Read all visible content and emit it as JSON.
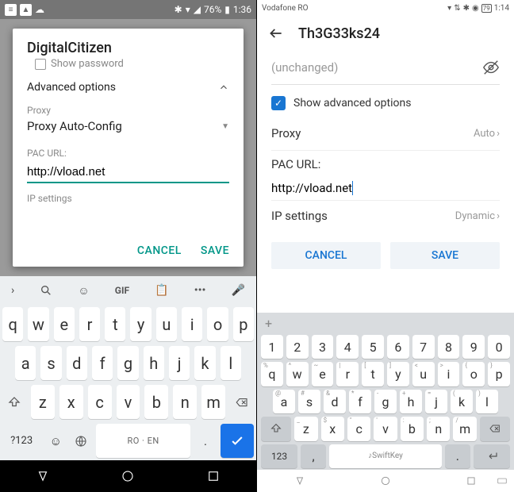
{
  "left": {
    "status": {
      "battery": "76%",
      "time": "1:36"
    },
    "dialog": {
      "title": "DigitalCitizen",
      "showPassword": "Show password",
      "advanced": "Advanced options",
      "proxyLabel": "Proxy",
      "proxyValue": "Proxy Auto-Config",
      "pacLabel": "PAC URL:",
      "pacValue": "http://vload.net",
      "ipSettings": "IP settings",
      "cancel": "CANCEL",
      "save": "SAVE"
    },
    "keyboard": {
      "gif": "GIF",
      "row1": [
        "q",
        "w",
        "e",
        "r",
        "t",
        "y",
        "u",
        "i",
        "o",
        "p"
      ],
      "row2": [
        "a",
        "s",
        "d",
        "f",
        "g",
        "h",
        "j",
        "k",
        "l"
      ],
      "row3": [
        "z",
        "x",
        "c",
        "v",
        "b",
        "n",
        "m"
      ],
      "numToggle": "?123",
      "space": "RO · EN",
      "period": "."
    }
  },
  "right": {
    "status": {
      "carrier": "Vodafone RO",
      "battery": "79",
      "time": "1:14"
    },
    "title": "Th3G33ks24",
    "unchanged": "(unchanged)",
    "showAdvanced": "Show advanced options",
    "proxy": {
      "label": "Proxy",
      "value": "Auto"
    },
    "pacLabel": "PAC URL:",
    "pacValue": "http://vload.net",
    "ipSettings": {
      "label": "IP settings",
      "value": "Dynamic"
    },
    "cancel": "CANCEL",
    "save": "SAVE",
    "keyboard": {
      "numRow": [
        "1",
        "2",
        "3",
        "4",
        "5",
        "6",
        "7",
        "8",
        "9",
        "0"
      ],
      "row1": [
        [
          "q",
          "%"
        ],
        [
          "w",
          "^"
        ],
        [
          "e",
          "~"
        ],
        [
          "r",
          "|"
        ],
        [
          "t",
          "["
        ],
        [
          "y",
          "]"
        ],
        [
          "u",
          "<"
        ],
        [
          "i",
          ">"
        ],
        [
          "o",
          "{"
        ],
        [
          "p",
          "}"
        ]
      ],
      "row2": [
        [
          "a",
          "@"
        ],
        [
          "s",
          "#"
        ],
        [
          "d",
          "&"
        ],
        [
          "f",
          "*"
        ],
        [
          "g",
          "-"
        ],
        [
          "h",
          "+"
        ],
        [
          "j",
          "="
        ],
        [
          "k",
          "("
        ],
        [
          "l",
          ")"
        ]
      ],
      "row3": [
        [
          "z",
          "_"
        ],
        [
          "x",
          "$"
        ],
        [
          "c",
          "\""
        ],
        [
          "v",
          "'"
        ],
        [
          "b",
          ":"
        ],
        [
          "n",
          ";"
        ],
        [
          "m",
          "/"
        ]
      ],
      "numToggle": "123",
      "space": "SwiftKey"
    }
  }
}
